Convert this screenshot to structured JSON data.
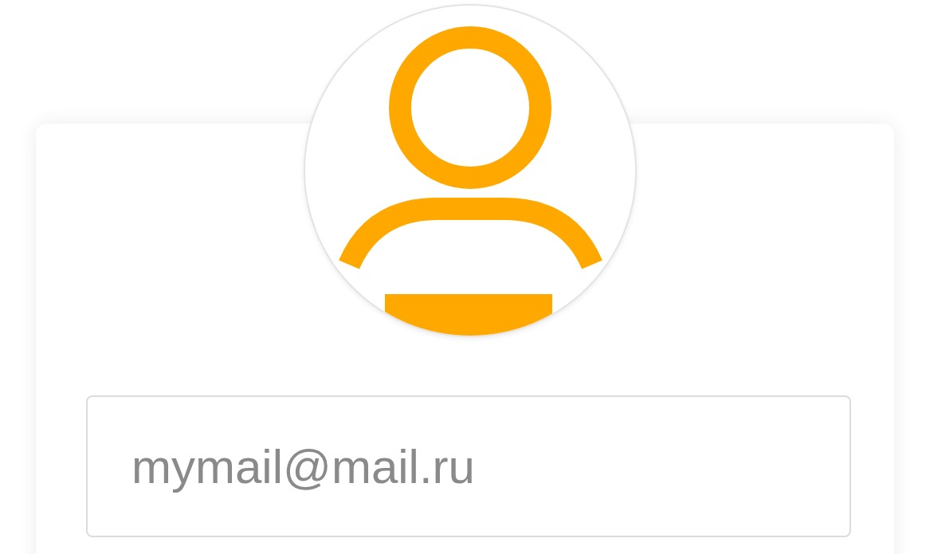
{
  "login_form": {
    "email_field": {
      "placeholder": "mymail@mail.ru"
    }
  }
}
